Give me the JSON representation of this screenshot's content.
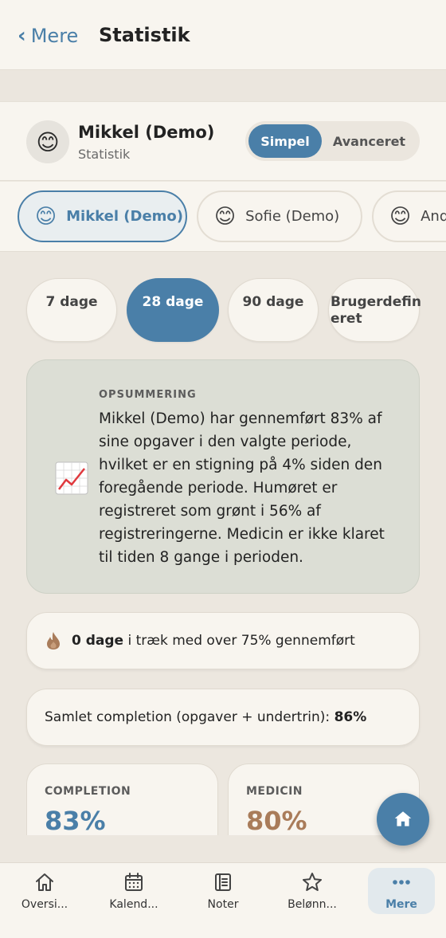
{
  "header": {
    "back_label": "Mere",
    "title": "Statistik"
  },
  "profile": {
    "name": "Mikkel (Demo)",
    "subtitle": "Statistik",
    "mode_options": [
      "Simpel",
      "Avanceret"
    ],
    "selected_mode": "Simpel"
  },
  "people": [
    {
      "name": "Mikkel (Demo)",
      "selected": true
    },
    {
      "name": "Sofie (Demo)",
      "selected": false
    },
    {
      "name": "And",
      "selected": false
    }
  ],
  "ranges": [
    "7 dage",
    "28 dage",
    "90 dage",
    "Brugerdefineret"
  ],
  "ranges_custom_lines": [
    "Brugerdefin",
    "eret"
  ],
  "selected_range": "28 dage",
  "summary": {
    "label": "OPSUMMERING",
    "text": "Mikkel (Demo) har gennemført 83% af sine opgaver i den valgte periode, hvilket er en stigning på 4% siden den foregående periode. Humøret er registreret som grønt i 56% af registreringerne. Medicin er ikke klaret til tiden 8 gange i perioden."
  },
  "streak": {
    "days": "0 dage",
    "rest": " i træk med over 75% gennemført"
  },
  "total_completion": {
    "label": "Samlet completion (opgaver + undertrin): ",
    "value": "86%"
  },
  "stats": [
    {
      "label": "COMPLETION",
      "value": "83%",
      "color": "#4a7fa8"
    },
    {
      "label": "MEDICIN",
      "value": "80%",
      "color": "#a97c5a"
    }
  ],
  "tabs": [
    {
      "label": "Oversi...",
      "icon": "home-icon"
    },
    {
      "label": "Kalend...",
      "icon": "calendar-icon"
    },
    {
      "label": "Noter",
      "icon": "notes-icon"
    },
    {
      "label": "Belønn...",
      "icon": "star-icon"
    },
    {
      "label": "Mere",
      "icon": "more-icon",
      "active": true
    }
  ],
  "colors": {
    "accent": "#4a7fa8",
    "medicine": "#a97c5a",
    "background": "#ece7df",
    "card": "#f8f5ef",
    "summary_card": "#dcded5"
  }
}
